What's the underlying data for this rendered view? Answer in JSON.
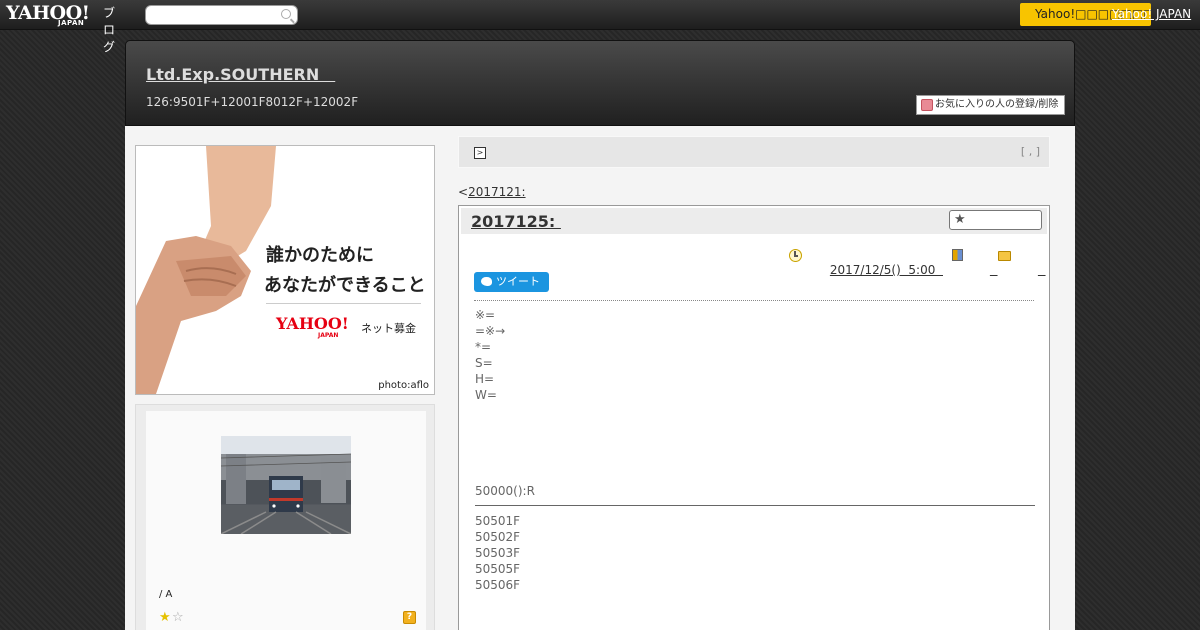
{
  "topbar": {
    "logo_main": "YAHOO!",
    "logo_sub": "JAPAN",
    "logo_blog": "ブログ",
    "search_placeholder": "",
    "yahoo_button": "Yahoo!□□□□□□□",
    "yahoo_japan_link": "Yahoo! JAPAN"
  },
  "header": {
    "title": "Ltd.Exp.SOUTHERN　",
    "description": "126:9501F+12001F8012F+12002F",
    "fav_button": "お気に入りの人の登録/削除"
  },
  "ad": {
    "line1": "誰かのために",
    "line2": "あなたができること",
    "logo": "YAHOO!",
    "logo_sub": "JAPAN",
    "service": "ネット募金",
    "credit": "photo:aflo"
  },
  "profile": {
    "name": "/ A",
    "rating": 1,
    "rating_max": 2,
    "help": "?"
  },
  "nav": {
    "arrow": ">",
    "right_text": "[ , ]"
  },
  "prev_link": {
    "prefix": "<",
    "text": "2017121: "
  },
  "article": {
    "title": "2017125: ",
    "datetime": "2017/12/5()  5:00  ",
    "category1": "  ",
    "category2": "  ",
    "tweet": "ツイート",
    "lines": [
      "※=",
      "=※→",
      "*=",
      "S=",
      "H=",
      "W="
    ],
    "summary": "50000():R",
    "cars": [
      "50501F",
      "50502F",
      "50503F",
      "50505F",
      "50506F"
    ]
  },
  "colors": {
    "accent_yellow": "#f8c400",
    "tweet_blue": "#1b95e0",
    "ad_red": "#e60012"
  }
}
